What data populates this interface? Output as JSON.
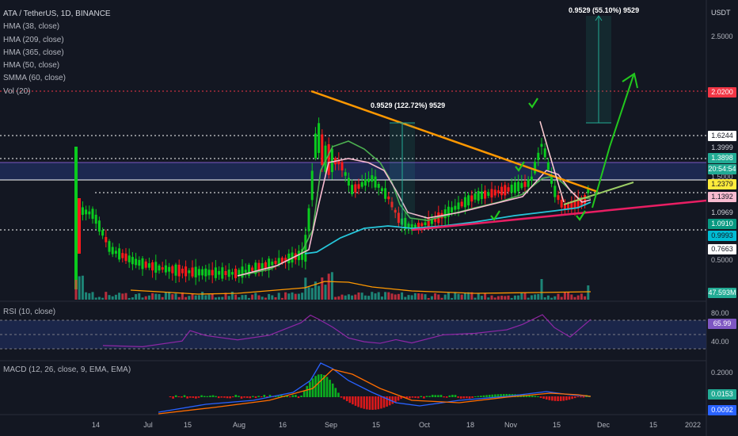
{
  "header": {
    "title": "ATA / TetherUS, 1D, BINANCE",
    "currency_button": "USDT"
  },
  "indicators": [
    "HMA (38, close)",
    "HMA (209, close)",
    "HMA (365, close)",
    "HMA (50, close)",
    "SMMA (60, close)",
    "Vol (20)"
  ],
  "rsi_label": "RSI (10, close)",
  "macd_label": "MACD (12, 26, close, 9, EMA, EMA)",
  "measurements": {
    "left": "0.9529 (122.72%) 9529",
    "right": "0.9529 (55.10%) 9529"
  },
  "price_axis": {
    "ticks": [
      "2.5000",
      "1.5000",
      "0.5000"
    ],
    "rsi_ticks": [
      "80.00",
      "40.00"
    ],
    "macd_ticks": [
      "0.2000"
    ],
    "tags": [
      {
        "label": "2.0200",
        "bg": "#f23645",
        "fg": "#ffffff"
      },
      {
        "label": "1.6244",
        "bg": "#ffffff",
        "fg": "#131722"
      },
      {
        "label": "1.3999",
        "bg": "#131722",
        "fg": "#d1d4dc"
      },
      {
        "label": "1.3898",
        "bg": "#22ab94",
        "fg": "#ffffff"
      },
      {
        "label": "20:54:54",
        "bg": "#22ab94",
        "fg": "#ffffff"
      },
      {
        "label": "1.2379",
        "bg": "#ffeb3b",
        "fg": "#131722"
      },
      {
        "label": "1.1392",
        "bg": "#f8bbd0",
        "fg": "#131722"
      },
      {
        "label": "1.0969",
        "bg": "#131722",
        "fg": "#d1d4dc"
      },
      {
        "label": "1.0910",
        "bg": "#089981",
        "fg": "#ffffff"
      },
      {
        "label": "0.9993",
        "bg": "#00bcd4",
        "fg": "#131722"
      },
      {
        "label": "0.7663",
        "bg": "#ffffff",
        "fg": "#131722"
      },
      {
        "label": "47.593M",
        "bg": "#22ab94",
        "fg": "#ffffff"
      },
      {
        "label": "65.99",
        "bg": "#7e57c2",
        "fg": "#ffffff"
      },
      {
        "label": "0.0153",
        "bg": "#22ab94",
        "fg": "#ffffff"
      },
      {
        "label": "0.0092",
        "bg": "#2962ff",
        "fg": "#ffffff"
      }
    ]
  },
  "time_axis": [
    "14",
    "Jul",
    "15",
    "Aug",
    "16",
    "Sep",
    "15",
    "Oct",
    "18",
    "Nov",
    "15",
    "Dec",
    "15",
    "2022"
  ],
  "colors": {
    "background": "#131722",
    "up": "#22ab94",
    "down": "#f23645",
    "green_candle": "#0acb1e",
    "red_candle": "#ff1a1a",
    "hma38": "#4caf50",
    "hma50": "#f8bbd0",
    "smma60": "#26c6da",
    "trend_orange": "#ff9800",
    "trend_pink": "#e91e63",
    "rsi": "#9c27b0",
    "macd": "#2962ff",
    "signal": "#ff6d00"
  }
}
